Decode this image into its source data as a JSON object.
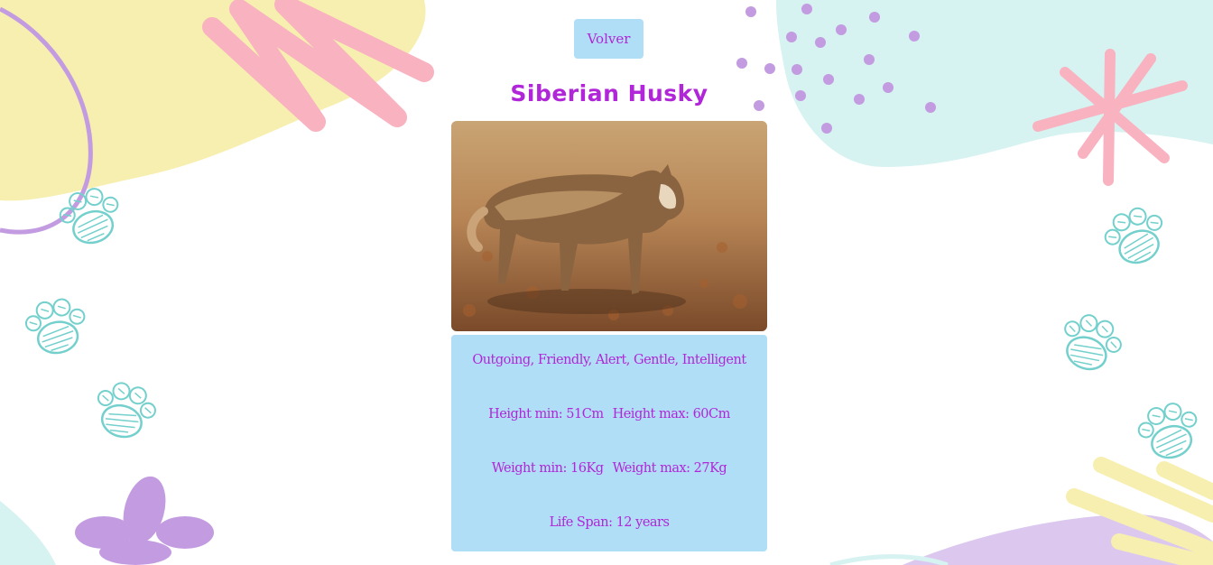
{
  "back_button": {
    "label": "Volver"
  },
  "breed": {
    "name": "Siberian Husky",
    "temperament": "Outgoing, Friendly, Alert, Gentle, Intelligent",
    "height_min": "Height min: 51Cm",
    "height_max": "Height max: 60Cm",
    "weight_min": "Weight min: 16Kg",
    "weight_max": "Weight max: 27Kg",
    "life_span": "Life Span: 12 years"
  },
  "colors": {
    "accent": "#b026d8",
    "card": "#b1def7",
    "yellow": "#f7efb0",
    "pink": "#f8b2c0",
    "mint": "#d6f2f1",
    "lilac": "#c39be0",
    "paw": "#73d0cc"
  }
}
